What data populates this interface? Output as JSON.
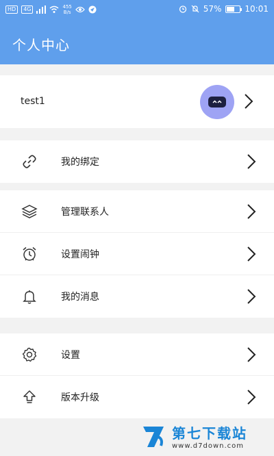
{
  "status_bar": {
    "left_badges": [
      "HD",
      "4G"
    ],
    "speed": "455",
    "speed_unit": "B/s",
    "battery": "57%",
    "time": "10:01"
  },
  "header": {
    "title": "个人中心"
  },
  "profile": {
    "username": "test1"
  },
  "menu": {
    "binding": "我的绑定",
    "contacts": "管理联系人",
    "alarm": "设置闹钟",
    "messages": "我的消息",
    "settings": "设置",
    "upgrade": "版本升级"
  },
  "watermark": {
    "title": "第七下载站",
    "url": "www.d7down.com"
  },
  "colors": {
    "header": "#5f9fec",
    "avatar": "#9ea3f4",
    "watermark": "#1a85d6"
  }
}
